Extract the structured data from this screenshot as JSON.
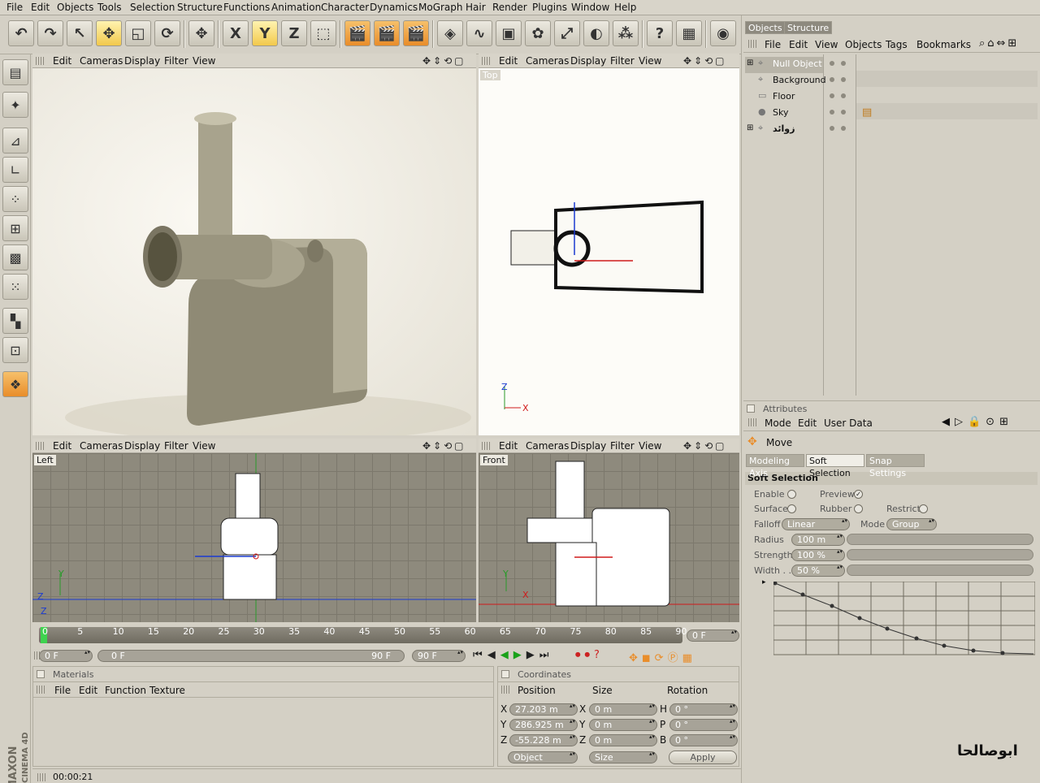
{
  "menu": [
    "File",
    "Edit",
    "Objects",
    "Tools",
    "Selection",
    "Structure",
    "Functions",
    "Animation",
    "Character",
    "Dynamics",
    "MoGraph",
    "Hair",
    "Render",
    "Plugins",
    "Window",
    "Help"
  ],
  "toolbar": {
    "buttons": [
      {
        "name": "undo-button",
        "icon": "undo-icon",
        "glyph": "↶"
      },
      {
        "name": "redo-button",
        "icon": "redo-icon",
        "glyph": "↷"
      },
      {
        "name": "live-selection-button",
        "icon": "cursor-arrow-icon",
        "glyph": "↖"
      },
      {
        "name": "move-tool-button",
        "icon": "move-icon",
        "glyph": "✥"
      },
      {
        "name": "scale-tool-button",
        "icon": "scale-icon",
        "glyph": "◱"
      },
      {
        "name": "rotate-tool-button",
        "icon": "rotate-icon",
        "glyph": "⟳"
      },
      {
        "name": "axis-move-button",
        "icon": "move-icon",
        "glyph": "✥"
      },
      {
        "name": "x-axis-lock-button",
        "icon": "x-axis-icon",
        "glyph": "X"
      },
      {
        "name": "y-axis-lock-button",
        "icon": "y-axis-icon",
        "glyph": "Y"
      },
      {
        "name": "z-axis-lock-button",
        "icon": "z-axis-icon",
        "glyph": "Z"
      },
      {
        "name": "world-coordinate-button",
        "icon": "coordinate-system-icon",
        "glyph": "⬚"
      },
      {
        "name": "render-view-button",
        "icon": "clapboard-icon",
        "glyph": "🎬"
      },
      {
        "name": "render-picture-viewer-button",
        "icon": "clapboard-icon",
        "glyph": "🎬"
      },
      {
        "name": "render-settings-button",
        "icon": "clapboard-icon",
        "glyph": "🎬"
      },
      {
        "name": "cube-object-button",
        "icon": "cube-icon",
        "glyph": "◈"
      },
      {
        "name": "spline-button",
        "icon": "spline-icon",
        "glyph": "∿"
      },
      {
        "name": "nurbs-button",
        "icon": "nurbs-icon",
        "glyph": "▣"
      },
      {
        "name": "array-button",
        "icon": "array-flower-icon",
        "glyph": "✿"
      },
      {
        "name": "deformer-button",
        "icon": "deformer-icon",
        "glyph": "⤢"
      },
      {
        "name": "environment-button",
        "icon": "sphere-icon",
        "glyph": "◐"
      },
      {
        "name": "scene-object-button",
        "icon": "particles-icon",
        "glyph": "⁂"
      },
      {
        "name": "help-cursor-button",
        "icon": "help-cursor-icon",
        "glyph": "?"
      },
      {
        "name": "layout-help-button",
        "icon": "table-help-icon",
        "glyph": "▦"
      },
      {
        "name": "browser-button",
        "icon": "globe-icon",
        "glyph": "◉"
      }
    ]
  },
  "left_tools": [
    {
      "name": "layout-switch-button",
      "icon": "layout-icon",
      "glyph": "▤"
    },
    {
      "name": "model-tool-button",
      "icon": "model-icon",
      "glyph": "✦"
    },
    {
      "name": "object-tool-button",
      "icon": "object-axis-icon",
      "glyph": "⊿"
    },
    {
      "name": "axis-tool-button",
      "icon": "axis-icon",
      "glyph": "∟"
    },
    {
      "name": "points-tool-button",
      "icon": "points-icon",
      "glyph": "⁘"
    },
    {
      "name": "edges-tool-button",
      "icon": "edges-icon",
      "glyph": "⊞"
    },
    {
      "name": "polygons-tool-button",
      "icon": "polygons-icon",
      "glyph": "▩"
    },
    {
      "name": "uvw-points-button",
      "icon": "uvw-icon",
      "glyph": "⁙"
    },
    {
      "name": "texture-tool-button",
      "icon": "checker-icon",
      "glyph": "▚"
    },
    {
      "name": "texture-axis-button",
      "icon": "texture-axis-icon",
      "glyph": "⊡"
    },
    {
      "name": "tweak-mode-button",
      "icon": "tweak-icon",
      "glyph": "❖"
    }
  ],
  "viewport_menu": [
    "Edit",
    "Cameras",
    "Display",
    "Filter",
    "View"
  ],
  "viewports": {
    "perspective": {
      "label": ""
    },
    "top": {
      "label": "Top"
    },
    "left": {
      "label": "Left"
    },
    "front": {
      "label": "Front"
    }
  },
  "timeline": {
    "ticks": [
      "0",
      "5",
      "10",
      "15",
      "20",
      "25",
      "30",
      "35",
      "40",
      "45",
      "50",
      "55",
      "60",
      "65",
      "70",
      "75",
      "80",
      "85",
      "90"
    ],
    "current_frame": "0 F",
    "start_frame": "0 F",
    "range_start": "0 F",
    "range_end": "90 F",
    "end_frame": "90 F"
  },
  "materials": {
    "title": "Materials",
    "menu": [
      "File",
      "Edit",
      "Function",
      "Texture"
    ]
  },
  "coordinates": {
    "title": "Coordinates",
    "headers": [
      "Position",
      "Size",
      "Rotation"
    ],
    "rows": [
      {
        "axis": "X",
        "pos": "27.203 m",
        "size_axis": "X",
        "size": "0 m",
        "rot_axis": "H",
        "rot": "0 °"
      },
      {
        "axis": "Y",
        "pos": "286.925 m",
        "size_axis": "Y",
        "size": "0 m",
        "rot_axis": "P",
        "rot": "0 °"
      },
      {
        "axis": "Z",
        "pos": "-55.228 m",
        "size_axis": "Z",
        "size": "0 m",
        "rot_axis": "B",
        "rot": "0 °"
      }
    ],
    "mode": "Object",
    "size_mode": "Size",
    "apply": "Apply"
  },
  "objects_panel": {
    "tabs": [
      "Objects",
      "Structure"
    ],
    "menu": [
      "File",
      "Edit",
      "View",
      "Objects",
      "Tags",
      "Bookmarks"
    ],
    "items": [
      {
        "name": "Null Object",
        "selected": true
      },
      {
        "name": "Background",
        "selected": false
      },
      {
        "name": "Floor",
        "selected": false
      },
      {
        "name": "Sky",
        "selected": false
      },
      {
        "name": "زوائد",
        "selected": false
      }
    ]
  },
  "attributes": {
    "title": "Attributes",
    "menu": [
      "Mode",
      "Edit",
      "User Data"
    ],
    "tool": "Move",
    "tabs": [
      "Modeling Axis",
      "Soft Selection",
      "Snap Settings"
    ],
    "section": "Soft Selection",
    "enable": "Enable",
    "preview": "Preview",
    "surface": "Surface",
    "rubber": "Rubber",
    "restrict": "Restrict",
    "falloff_label": "Falloff",
    "falloff": "Linear",
    "mode_label": "Mode",
    "mode": "Group",
    "radius_label": "Radius",
    "radius": "100 m",
    "strength_label": "Strength",
    "strength": "100 %",
    "width_label": "Width . .",
    "width": "50 %"
  },
  "status": {
    "time": "00:00:21"
  },
  "branding": {
    "maxon": "MAXON",
    "c4d": "CINEMA 4D",
    "watermark": "ابوصالحا"
  },
  "colors": {
    "accent_orange": "#e98d2a",
    "panel": "#d4d0c5",
    "viewport_bg": "#ffffff"
  }
}
